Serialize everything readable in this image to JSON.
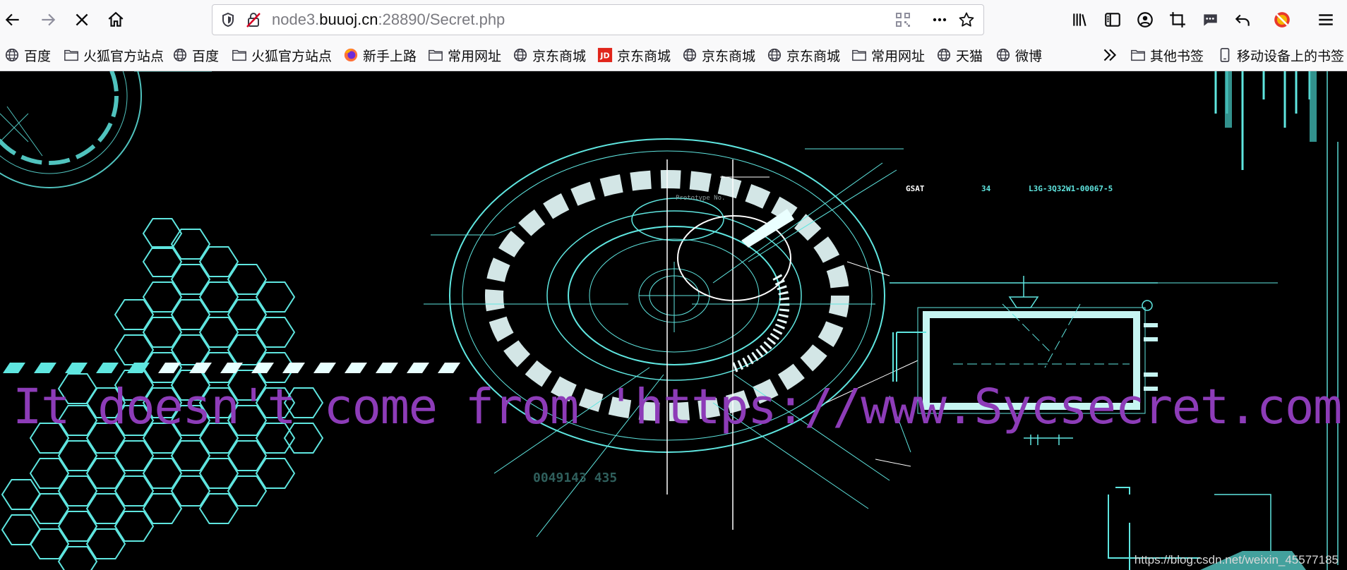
{
  "toolbar": {
    "url_prefix": "node3.",
    "url_host": "buuoj.cn",
    "url_suffix": ":28890/Secret.php"
  },
  "bookmarks": [
    {
      "label": "百度",
      "icon": "globe-icon"
    },
    {
      "label": "火狐官方站点",
      "icon": "folder-icon"
    },
    {
      "label": "百度",
      "icon": "globe-icon"
    },
    {
      "label": "火狐官方站点",
      "icon": "folder-icon"
    },
    {
      "label": "新手上路",
      "icon": "firefox-icon"
    },
    {
      "label": "常用网址",
      "icon": "folder-icon"
    },
    {
      "label": "京东商城",
      "icon": "globe-icon"
    },
    {
      "label": "京东商城",
      "icon": "jd-icon"
    },
    {
      "label": "京东商城",
      "icon": "globe-icon"
    },
    {
      "label": "京东商城",
      "icon": "globe-icon"
    },
    {
      "label": "常用网址",
      "icon": "folder-icon"
    },
    {
      "label": "天猫",
      "icon": "globe-icon"
    },
    {
      "label": "微博",
      "icon": "globe-icon"
    }
  ],
  "bookmarks_right": [
    {
      "label": "其他书签",
      "icon": "folder-icon"
    },
    {
      "label": "移动设备上的书签",
      "icon": "mobile-icon"
    }
  ],
  "hud_text": {
    "gsat_label": "GSAT",
    "gsat_value": "34",
    "code": "L3G-3Q32W1-00067-5",
    "prototype": "Prototype No.",
    "bottom_readout": "0049143 435"
  },
  "page": {
    "message": "It doesn't come from 'https://www.Sycsecret.com'",
    "watermark": "https://blog.csdn.net/weixin_45577185"
  },
  "colors": {
    "message": "#8d3cb8",
    "hud_cyan": "#5fe6e0",
    "background": "#000000"
  }
}
